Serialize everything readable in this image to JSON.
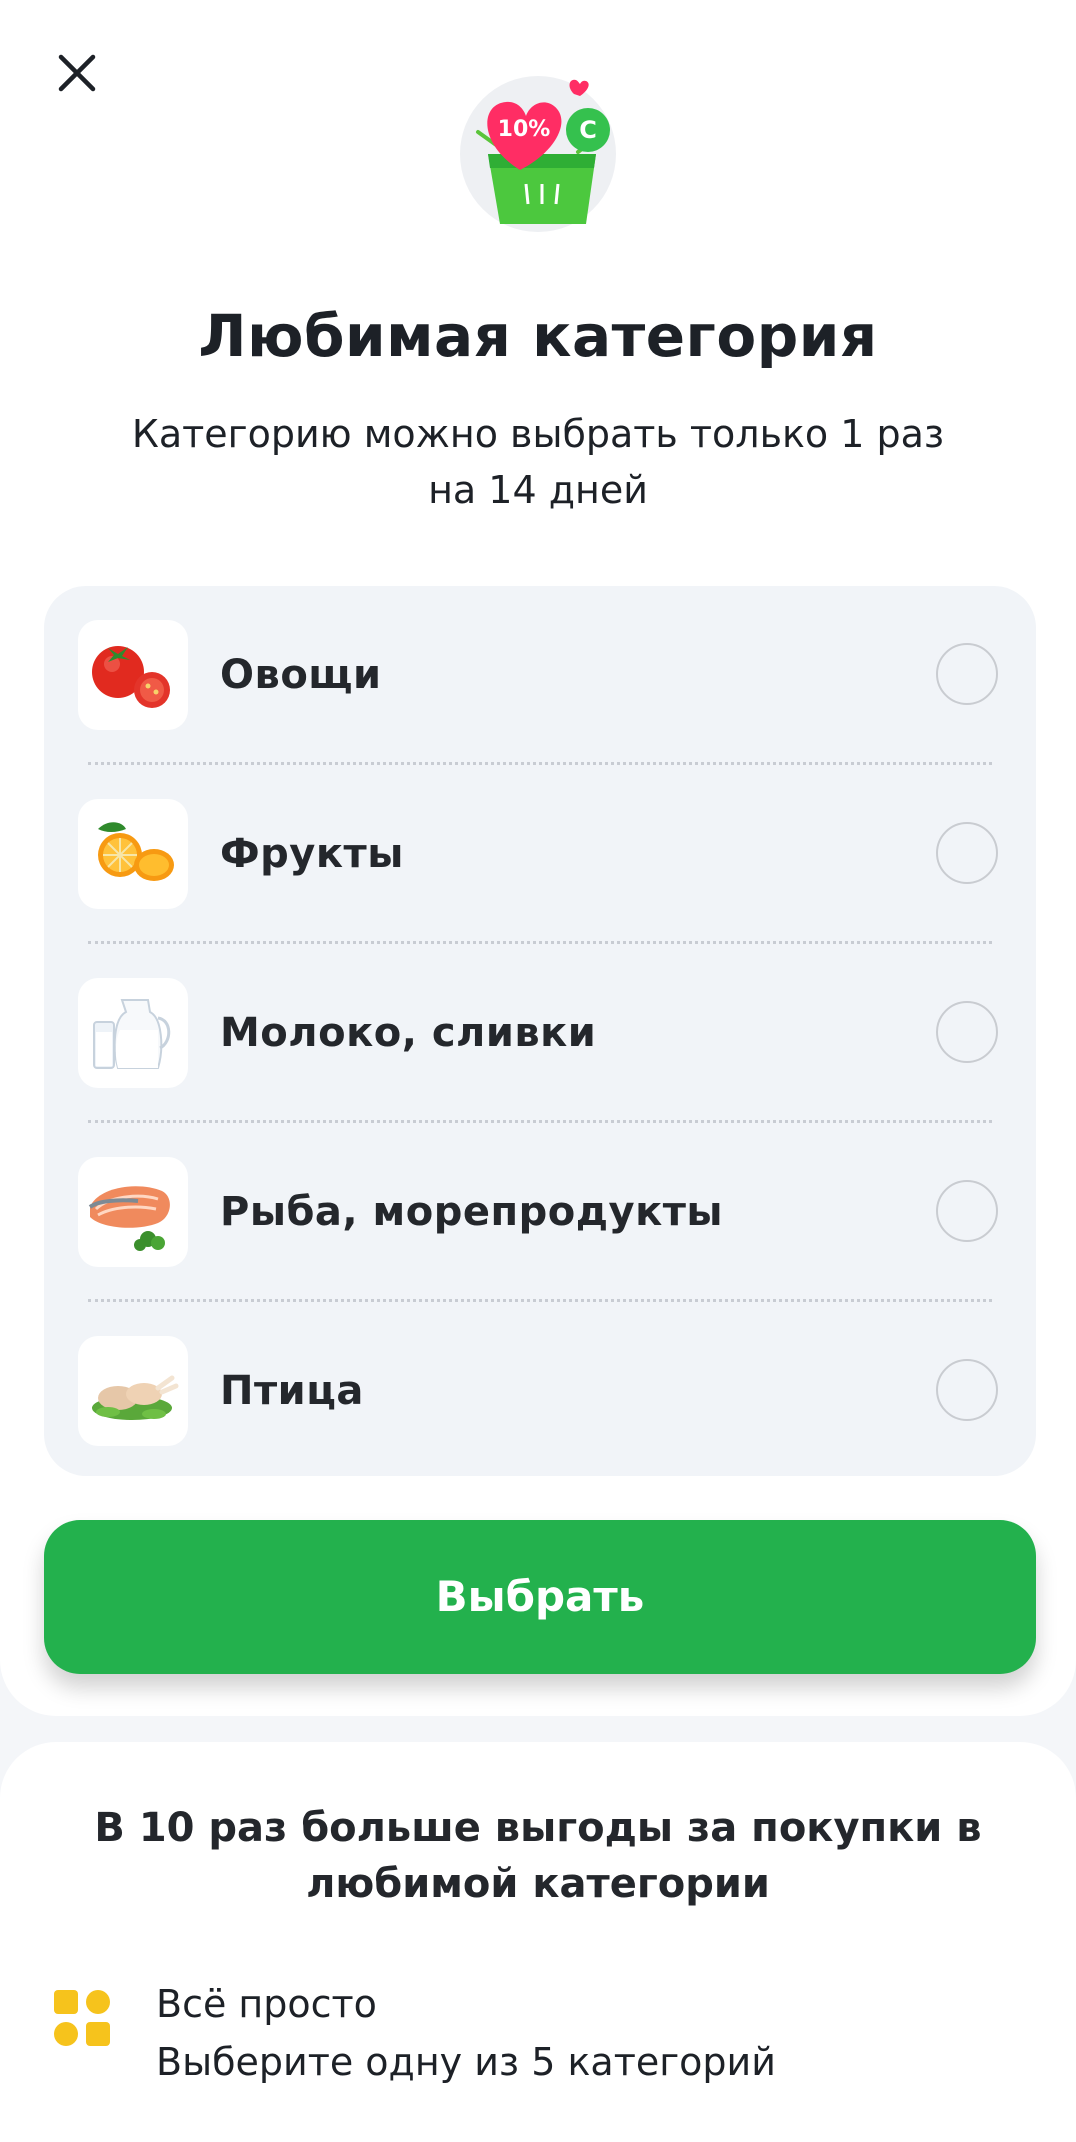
{
  "header": {
    "close_icon": "close-icon",
    "hero_icon": "basket-discount-icon",
    "hero_badge_percent": "10%",
    "hero_badge_currency": "C"
  },
  "title": "Любимая категория",
  "subtitle": "Категорию можно выбрать только 1 раз на 14 дней",
  "categories": [
    {
      "label": "Овощи",
      "icon": "tomato-icon",
      "selected": false
    },
    {
      "label": "Фрукты",
      "icon": "orange-icon",
      "selected": false
    },
    {
      "label": "Молоко, сливки",
      "icon": "milk-icon",
      "selected": false
    },
    {
      "label": "Рыба, морепродукты",
      "icon": "fish-icon",
      "selected": false
    },
    {
      "label": "Птица",
      "icon": "chicken-icon",
      "selected": false
    }
  ],
  "select_button": "Выбрать",
  "benefits": {
    "title": "В 10 раз больше выгоды за покупки в любимой категории",
    "items": [
      {
        "title": "Всё просто",
        "text": "Выберите одну из 5 категорий",
        "icon": "grid-shapes-icon"
      }
    ]
  },
  "colors": {
    "accent": "#23b14d",
    "card_bg": "#f1f4f8",
    "feature_icon": "#f6c31c"
  }
}
